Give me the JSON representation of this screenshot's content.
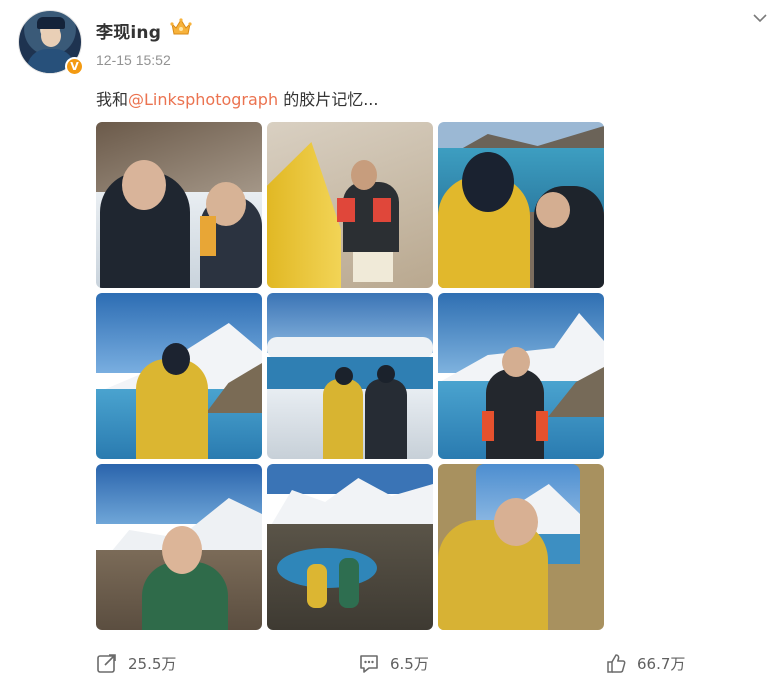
{
  "post": {
    "username": "李现ing",
    "timestamp": "12-15 15:52",
    "text_before": "我和",
    "mention": "@Linksphotograph",
    "text_after": " 的胶片记忆..."
  },
  "photos": [
    {
      "label": "photo-1"
    },
    {
      "label": "photo-2"
    },
    {
      "label": "photo-3"
    },
    {
      "label": "photo-4"
    },
    {
      "label": "photo-5"
    },
    {
      "label": "photo-6"
    },
    {
      "label": "photo-7"
    },
    {
      "label": "photo-8"
    },
    {
      "label": "photo-9"
    }
  ],
  "actions": {
    "share_count": "25.5万",
    "comment_count": "6.5万",
    "like_count": "66.7万"
  },
  "icons": {
    "verified": "verified-badge-icon",
    "crown": "crown-icon",
    "more": "chevron-down-icon",
    "share": "share-icon",
    "comment": "comment-icon",
    "like": "like-icon"
  },
  "colors": {
    "mention": "#eb7350",
    "verified": "#f39a12",
    "meta": "#939393"
  }
}
